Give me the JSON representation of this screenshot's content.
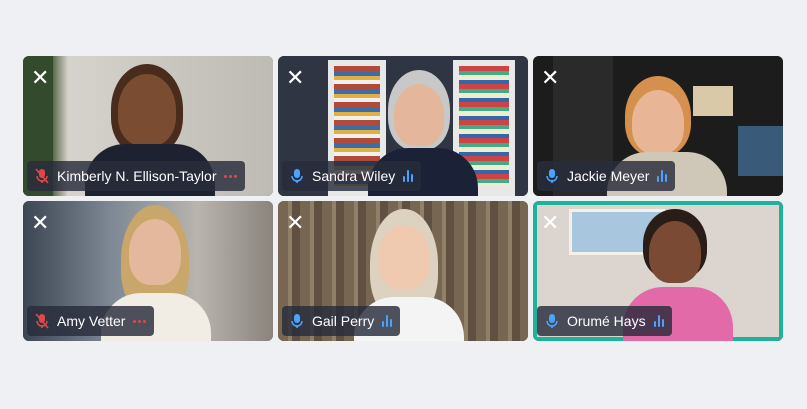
{
  "participants": [
    {
      "name": "Kimberly N. Ellison-Taylor",
      "muted": true,
      "speaking": false
    },
    {
      "name": "Sandra Wiley",
      "muted": false,
      "speaking": true
    },
    {
      "name": "Jackie Meyer",
      "muted": false,
      "speaking": true
    },
    {
      "name": "Amy Vetter",
      "muted": true,
      "speaking": false
    },
    {
      "name": "Gail Perry",
      "muted": false,
      "speaking": true
    },
    {
      "name": "Orumé Hays",
      "muted": false,
      "speaking": true,
      "active": true
    }
  ],
  "close_glyph": "✕",
  "colors": {
    "accent": "#1fb29b",
    "mic_on": "#4aa3ff",
    "mic_off": "#e04848",
    "background": "#eef0f3"
  }
}
